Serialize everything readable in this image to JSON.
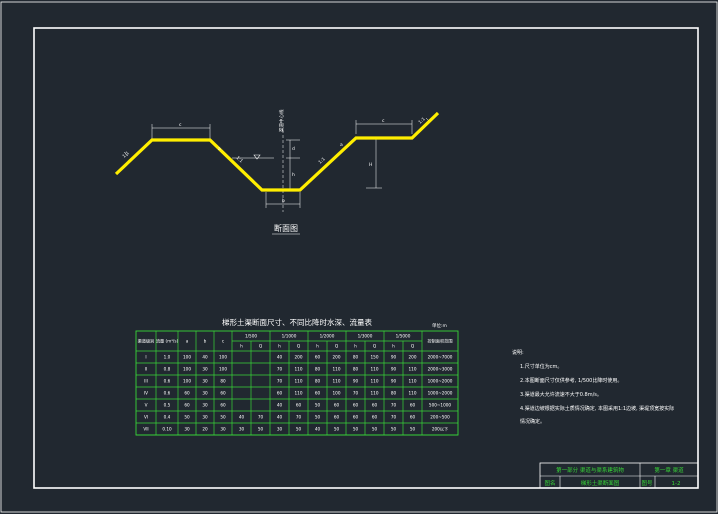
{
  "colors": {
    "background": "#212830",
    "frame": "#ffffff",
    "profile": "#ffee00",
    "table_grid": "#38d638",
    "text": "#ffffff",
    "title_text": "#38d638"
  },
  "section_drawing": {
    "section_label": "断面图",
    "centerline_label": "渠道中心线",
    "slope_left_top": "1:1",
    "slope_left_mid": "1:1",
    "slope_right_mid": "1:1",
    "slope_right_top": "1:1",
    "dim_berm_left": "c",
    "dim_berm_right": "c",
    "dim_bottom": "b",
    "dim_depth_water": "h",
    "dim_depth_total": "H",
    "dim_freeboard": "d",
    "dim_bank_height": "H",
    "dim_small_left": "a",
    "dim_small_right": "a"
  },
  "table": {
    "title": "梯形土渠断面尺寸、不同比降时水深、流量表",
    "unit": "单位:m",
    "header_top": [
      "渠道级别",
      "流量 (m³/s)",
      "a",
      "b",
      "c",
      "1/500",
      "1/1000",
      "1/2000",
      "1/3000",
      "1/5000",
      "控制面积范围"
    ],
    "header_sub": [
      "h",
      "Q",
      "h",
      "Q",
      "h",
      "Q",
      "h",
      "Q",
      "h",
      "Q"
    ],
    "rows": [
      [
        "I",
        "1.0",
        "100",
        "40",
        "100",
        "",
        "",
        "40",
        "200",
        "60",
        "200",
        "80",
        "150",
        "90",
        "200",
        "2000~7000"
      ],
      [
        "II",
        "0.8",
        "100",
        "30",
        "100",
        "",
        "",
        "70",
        "110",
        "80",
        "110",
        "80",
        "110",
        "90",
        "110",
        "2000~3000"
      ],
      [
        "III",
        "0.6",
        "100",
        "30",
        "80",
        "",
        "",
        "70",
        "110",
        "80",
        "110",
        "90",
        "110",
        "90",
        "110",
        "1000~2000"
      ],
      [
        "IV",
        "0.6",
        "60",
        "30",
        "60",
        "",
        "",
        "60",
        "110",
        "60",
        "100",
        "70",
        "110",
        "80",
        "110",
        "1000~2000"
      ],
      [
        "V",
        "0.5",
        "60",
        "30",
        "60",
        "",
        "",
        "40",
        "60",
        "50",
        "60",
        "60",
        "60",
        "70",
        "60",
        "500~1000"
      ],
      [
        "VI",
        "0.4",
        "50",
        "30",
        "50",
        "40",
        "70",
        "40",
        "70",
        "50",
        "60",
        "60",
        "60",
        "70",
        "60",
        "200~500"
      ],
      [
        "VII",
        "0.10",
        "30",
        "20",
        "30",
        "30",
        "50",
        "30",
        "50",
        "40",
        "50",
        "50",
        "50",
        "50",
        "50",
        "200以下"
      ]
    ]
  },
  "notes": {
    "heading": "说明:",
    "items": [
      "1.尺寸单位为cm。",
      "2.本图断面尺寸仅供参考, 1/500比降时使用。",
      "3.渠道最大允许流速不大于0.8m/s。",
      "4.渠道边坡根据实际土质情况确定, 本图采用1:1边坡, 渠堤顶宽按实际",
      "  情况确定。"
    ]
  },
  "title_block": {
    "row1_left": "第一部分  渠道与渠系建筑物",
    "row1_right": "第一章  渠道",
    "row2_label": "图名",
    "row2_name": "梯形土渠断面图",
    "row2_no_label": "图号",
    "row2_no": "1-2"
  }
}
